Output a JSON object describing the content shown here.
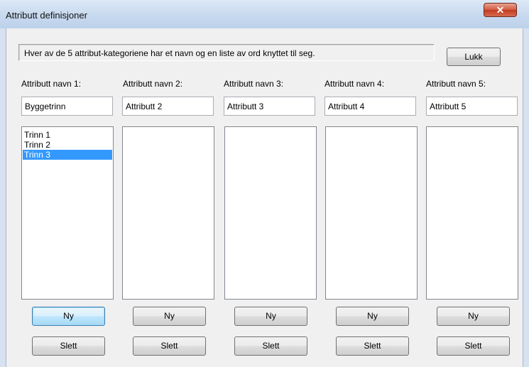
{
  "window": {
    "title": "Attributt definisjoner",
    "close_icon": "x-close-icon"
  },
  "info": {
    "text": "Hver av de 5 attribut-kategoriene har et navn og en liste av ord knyttet til seg."
  },
  "close_button": {
    "label": "Lukk"
  },
  "columns": [
    {
      "label": "Attributt navn 1:",
      "value": "Byggetrinn",
      "items": [
        "Trinn 1",
        "Trinn 2",
        "Trinn 3"
      ],
      "selected_item": "Trinn 3",
      "new_label": "Ny",
      "delete_label": "Slett"
    },
    {
      "label": "Attributt navn 2:",
      "value": "Attributt 2",
      "items": [],
      "new_label": "Ny",
      "delete_label": "Slett"
    },
    {
      "label": "Attributt navn 3:",
      "value": "Attributt 3",
      "items": [],
      "new_label": "Ny",
      "delete_label": "Slett"
    },
    {
      "label": "Attributt navn 4:",
      "value": "Attributt 4",
      "items": [],
      "new_label": "Ny",
      "delete_label": "Slett"
    },
    {
      "label": "Attributt navn 5:",
      "value": "Attributt 5",
      "items": [],
      "new_label": "Ny",
      "delete_label": "Slett"
    }
  ],
  "colors": {
    "selection": "#3399ff",
    "close_button": "#c94b32"
  }
}
